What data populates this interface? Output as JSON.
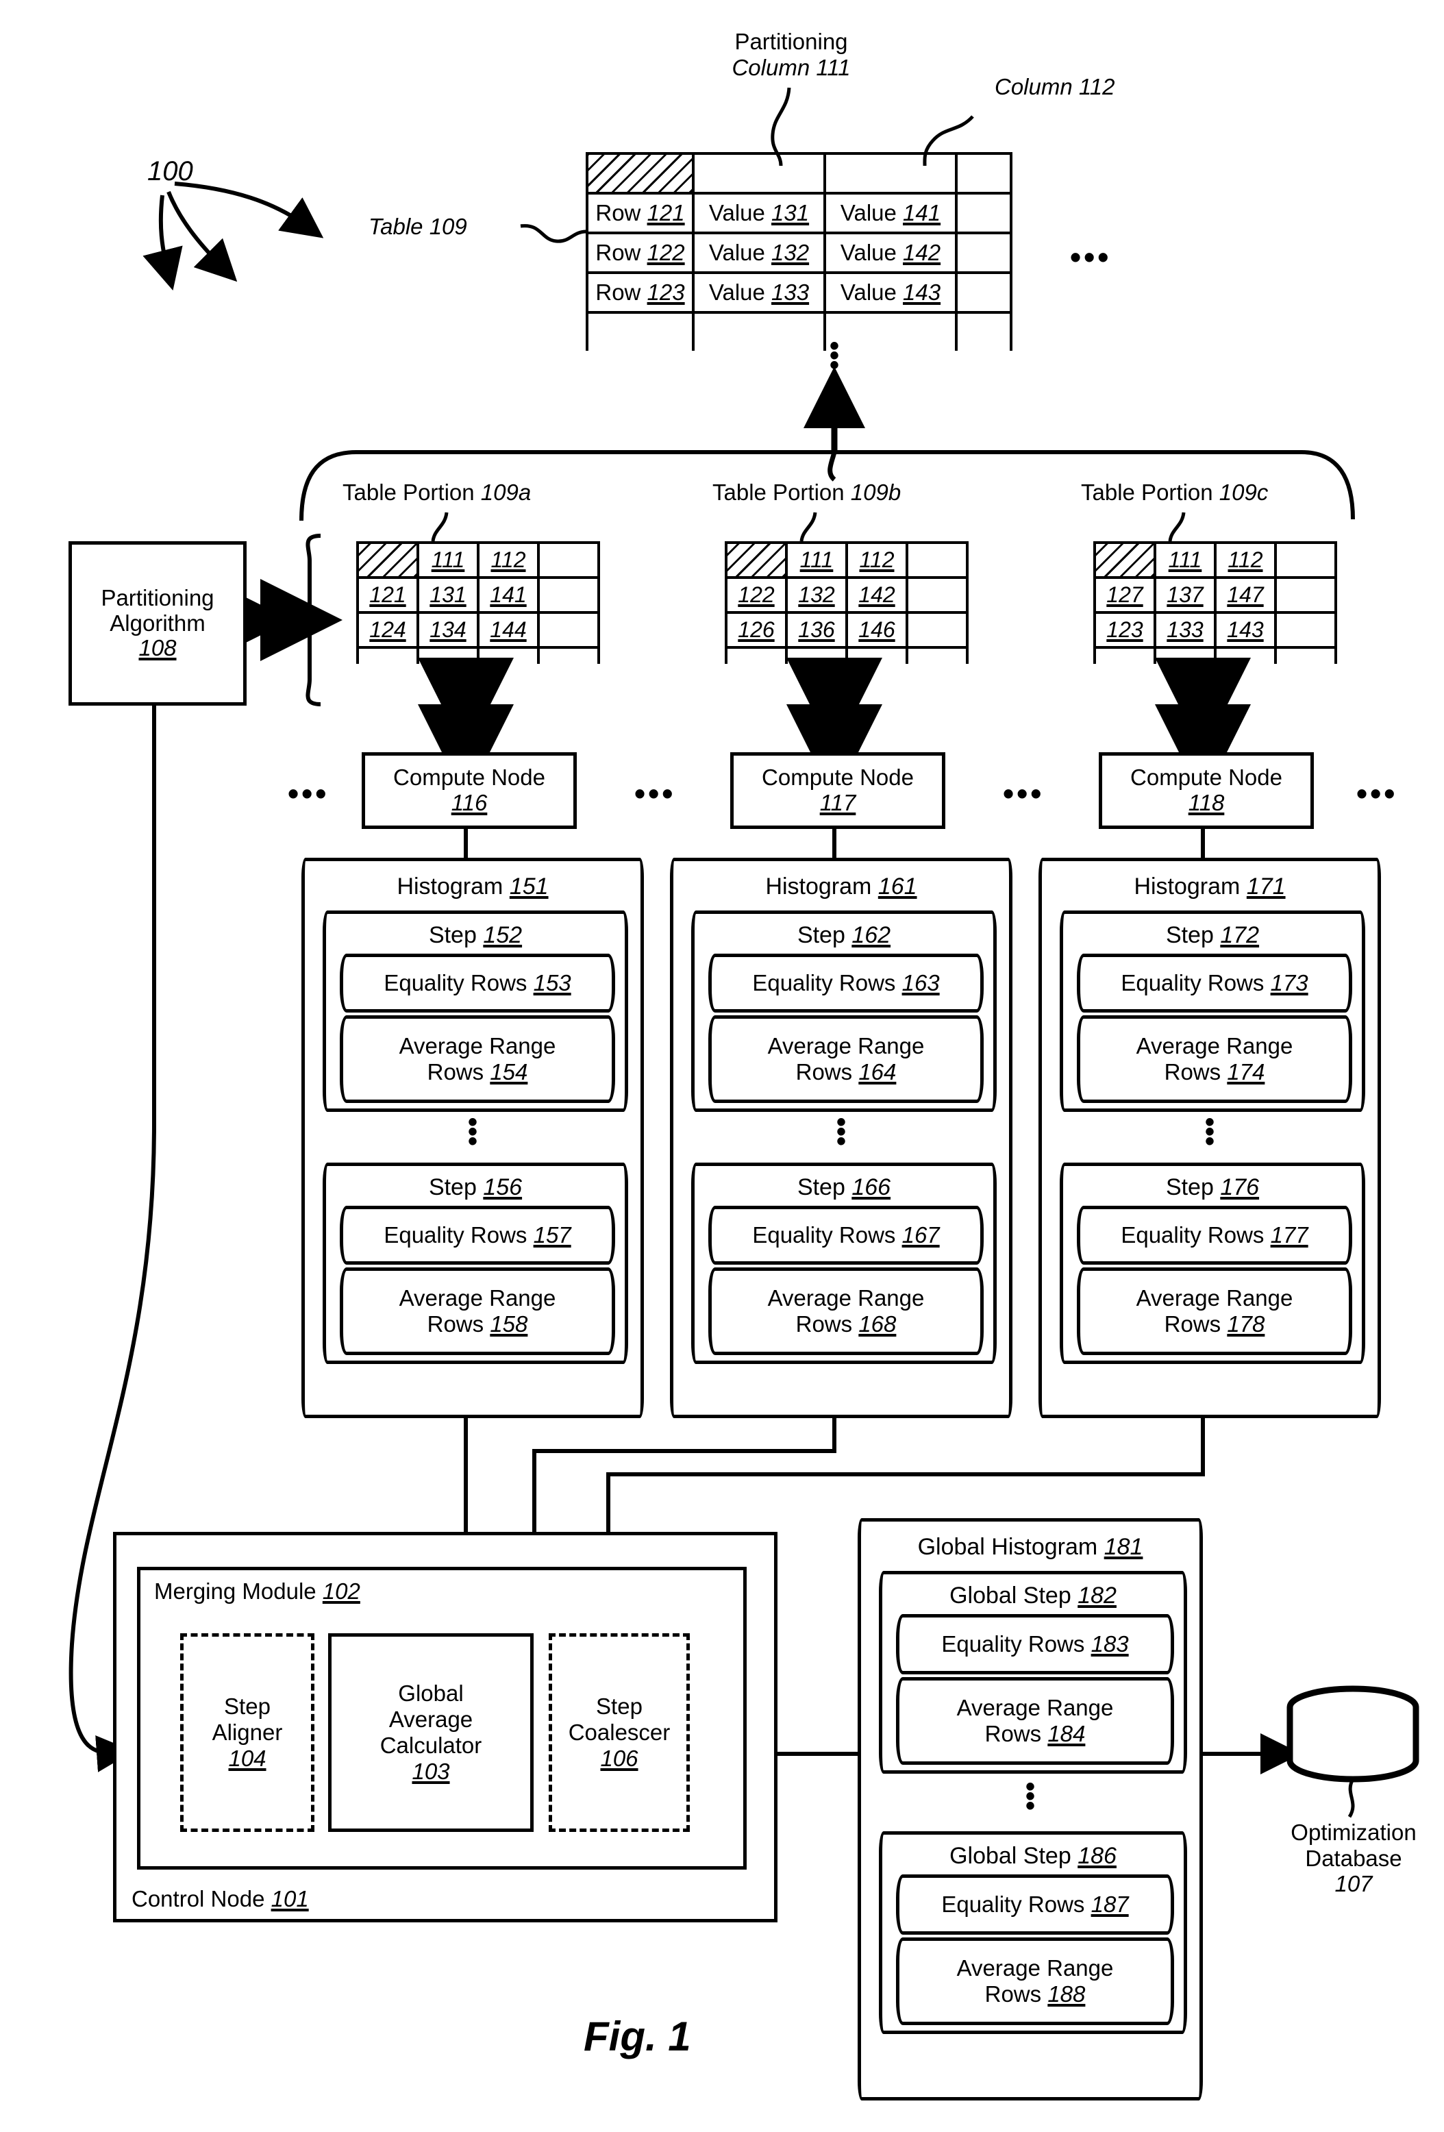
{
  "figure": {
    "caption": "Fig. 1",
    "system_ref": "100"
  },
  "top_table": {
    "label": "Table 109",
    "column_callouts": [
      {
        "name": "partitioning-column",
        "line1": "Partitioning",
        "line2": "Column 111"
      },
      {
        "name": "column-112",
        "line1": "",
        "line2": "Column 112"
      }
    ],
    "header_row": [
      "",
      "",
      "",
      ""
    ],
    "rows": [
      [
        "Row 121",
        "Value 131",
        "Value 141",
        ""
      ],
      [
        "Row 122",
        "Value 132",
        "Value 142",
        ""
      ],
      [
        "Row 123",
        "Value 133",
        "Value 143",
        ""
      ]
    ],
    "row_ellipsis": "⋮",
    "right_ellipsis": "•••"
  },
  "partitioning_algorithm": {
    "line1": "Partitioning",
    "line2": "Algorithm",
    "ref": "108"
  },
  "table_portions": [
    {
      "title": "Table Portion 109a",
      "header": [
        "",
        "111",
        "112",
        ""
      ],
      "rows": [
        [
          "121",
          "131",
          "141",
          ""
        ],
        [
          "124",
          "134",
          "144",
          ""
        ]
      ]
    },
    {
      "title": "Table Portion 109b",
      "header": [
        "",
        "111",
        "112",
        ""
      ],
      "rows": [
        [
          "122",
          "132",
          "142",
          ""
        ],
        [
          "126",
          "136",
          "146",
          ""
        ]
      ]
    },
    {
      "title": "Table Portion 109c",
      "header": [
        "",
        "111",
        "112",
        ""
      ],
      "rows": [
        [
          "127",
          "137",
          "147",
          ""
        ],
        [
          "123",
          "133",
          "143",
          ""
        ]
      ]
    }
  ],
  "compute_nodes": [
    {
      "label": "Compute Node",
      "ref": "116"
    },
    {
      "label": "Compute Node",
      "ref": "117"
    },
    {
      "label": "Compute Node",
      "ref": "118"
    }
  ],
  "node_ellipsis": "•••",
  "histograms": [
    {
      "title": "Histogram 151",
      "steps": [
        {
          "title": "Step 152",
          "equality": "Equality Rows 153",
          "avg_line1": "Average Range",
          "avg_line2": "Rows 154"
        },
        {
          "title": "Step 156",
          "equality": "Equality Rows 157",
          "avg_line1": "Average Range",
          "avg_line2": "Rows 158"
        }
      ]
    },
    {
      "title": "Histogram 161",
      "steps": [
        {
          "title": "Step 162",
          "equality": "Equality Rows 163",
          "avg_line1": "Average Range",
          "avg_line2": "Rows 164"
        },
        {
          "title": "Step 166",
          "equality": "Equality Rows 167",
          "avg_line1": "Average Range",
          "avg_line2": "Rows 168"
        }
      ]
    },
    {
      "title": "Histogram 171",
      "steps": [
        {
          "title": "Step 172",
          "equality": "Equality Rows 173",
          "avg_line1": "Average Range",
          "avg_line2": "Rows 174"
        },
        {
          "title": "Step 176",
          "equality": "Equality Rows 177",
          "avg_line1": "Average Range",
          "avg_line2": "Rows 178"
        }
      ]
    }
  ],
  "control_node": {
    "label": "Control Node 101",
    "merging_module": {
      "label": "Merging Module 102",
      "components": [
        {
          "line1": "Step",
          "line2": "Aligner",
          "ref": "104",
          "style": "dashed"
        },
        {
          "line1": "Global",
          "line2": "Average",
          "line3": "Calculator",
          "ref": "103",
          "style": "solid"
        },
        {
          "line1": "Step",
          "line2": "Coalescer",
          "ref": "106",
          "style": "dashed"
        }
      ]
    }
  },
  "global_histogram": {
    "title": "Global Histogram 181",
    "steps": [
      {
        "title": "Global Step 182",
        "equality": "Equality Rows 183",
        "avg_line1": "Average Range",
        "avg_line2": "Rows 184"
      },
      {
        "title": "Global Step 186",
        "equality": "Equality Rows 187",
        "avg_line1": "Average Range",
        "avg_line2": "Rows 188"
      }
    ]
  },
  "optimization_database": {
    "line1": "Optimization",
    "line2": "Database",
    "ref": "107"
  }
}
